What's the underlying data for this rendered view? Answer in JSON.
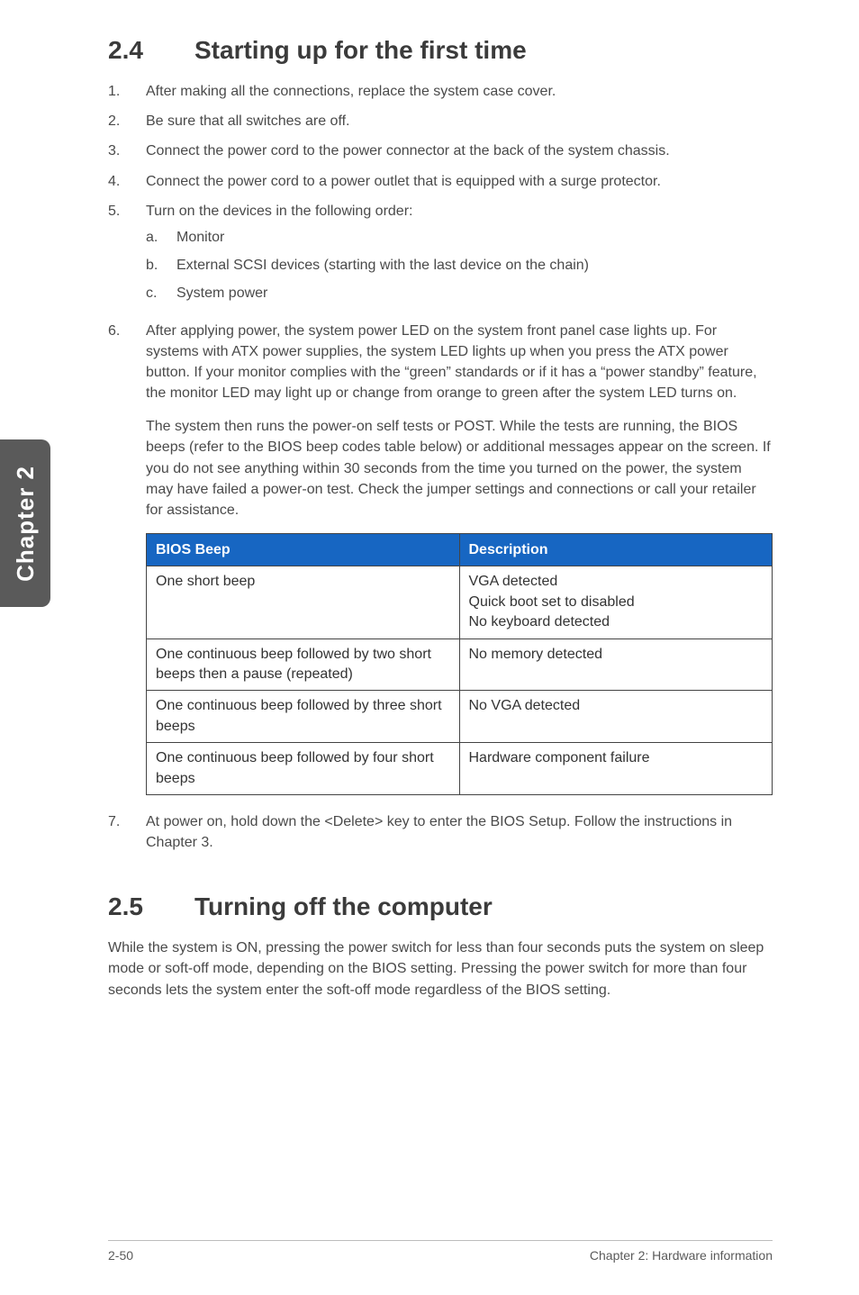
{
  "sideTab": "Chapter 2",
  "section24": {
    "num": "2.4",
    "title": "Starting up for the first time",
    "steps": [
      {
        "n": "1.",
        "text": "After making all the connections, replace the system case cover."
      },
      {
        "n": "2.",
        "text": "Be sure that all switches are off."
      },
      {
        "n": "3.",
        "text": "Connect the power cord to the power connector at the back of the system chassis."
      },
      {
        "n": "4.",
        "text": "Connect the power cord to a power outlet that is equipped with a surge protector."
      },
      {
        "n": "5.",
        "text": "Turn on the devices in the following order:"
      }
    ],
    "substeps": [
      {
        "l": "a.",
        "text": "Monitor"
      },
      {
        "l": "b.",
        "text": "External SCSI devices (starting with the last device on the chain)"
      },
      {
        "l": "c.",
        "text": "System power"
      }
    ],
    "step6n": "6.",
    "step6a": "After applying power, the system power LED on the system front panel case lights up. For systems with ATX power supplies, the system LED lights up when you press the ATX power button. If your monitor complies with the “green” standards or if it has a “power standby” feature, the monitor LED may light up or change from orange to green after the system LED turns on.",
    "step6b": "The system then runs the power-on self tests or POST. While the tests are running, the BIOS beeps (refer to the BIOS beep codes table below) or additional messages appear on the screen. If you do not see anything within 30 seconds from the time you turned on the power, the system may have failed a power-on test. Check the jumper settings and connections or call your retailer for assistance.",
    "table": {
      "headers": [
        "BIOS Beep",
        "Description"
      ],
      "rows": [
        [
          "One short beep",
          "VGA detected\nQuick boot set to disabled\nNo keyboard detected"
        ],
        [
          "One continuous beep followed by two short beeps then a pause (repeated)",
          "No memory detected"
        ],
        [
          "One continuous beep followed by three short beeps",
          "No VGA detected"
        ],
        [
          "One continuous beep followed by four short beeps",
          "Hardware component failure"
        ]
      ]
    },
    "step7n": "7.",
    "step7": "At power on, hold down the <Delete> key to enter the BIOS Setup. Follow the instructions in Chapter 3."
  },
  "section25": {
    "num": "2.5",
    "title": "Turning off the computer",
    "body": "While the system is ON, pressing the power switch for less than four seconds puts the system on sleep mode or soft-off mode, depending on the BIOS setting. Pressing the power switch for more than four seconds lets the system enter the soft-off mode regardless of the BIOS setting."
  },
  "footer": {
    "left": "2-50",
    "right": "Chapter 2: Hardware information"
  }
}
